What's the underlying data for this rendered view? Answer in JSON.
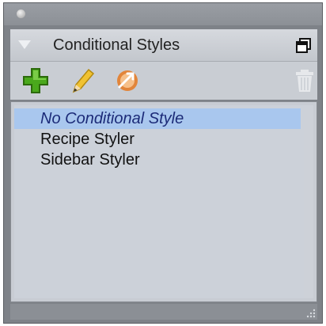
{
  "panel": {
    "title": "Conditional Styles"
  },
  "toolbar": {
    "buttons": [
      {
        "icon": "plus-icon",
        "label": ""
      },
      {
        "icon": "pencil-icon",
        "label": ""
      },
      {
        "icon": "apply-style-icon",
        "label": ""
      },
      {
        "icon": "trash-icon",
        "label": ""
      }
    ]
  },
  "list": {
    "items": [
      {
        "label": "No Conditional Style",
        "selected": true
      },
      {
        "label": "Recipe Styler",
        "selected": false
      },
      {
        "label": "Sidebar Styler",
        "selected": false
      }
    ]
  },
  "colors": {
    "selection": "#a9c7ee",
    "selection_text": "#1c2b78",
    "add_green": "#4aa81c",
    "pencil_yellow": "#f0c232",
    "apply_orange": "#e2853a"
  }
}
